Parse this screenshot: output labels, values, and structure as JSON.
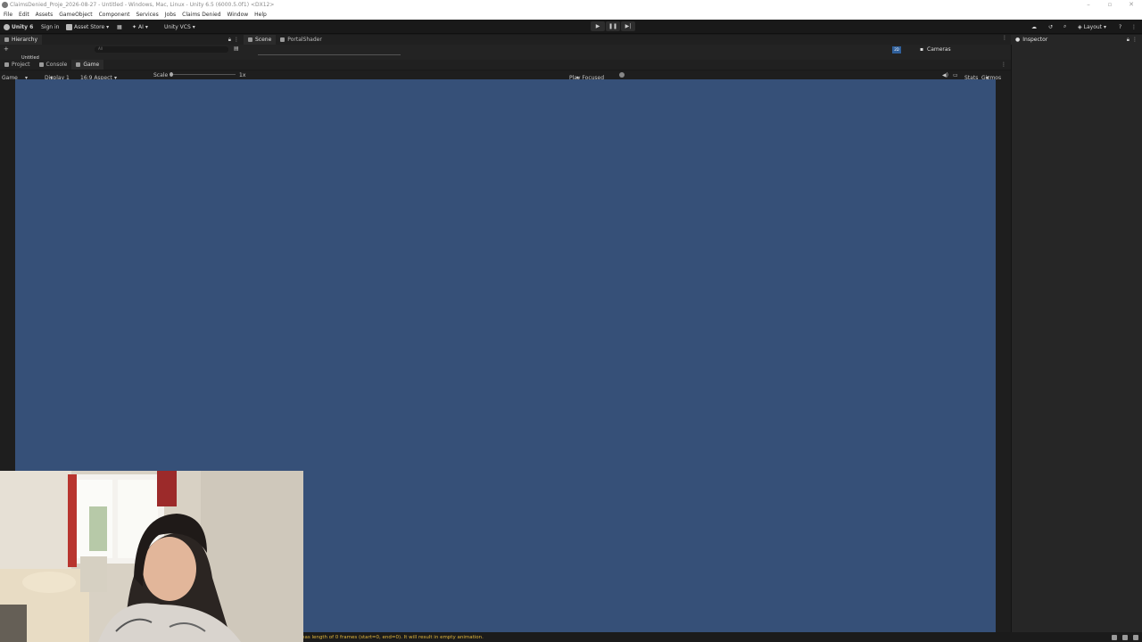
{
  "window": {
    "title": "ClaimsDenied_Proje_2026-08-27 - Untitled - Windows, Mac, Linux - Unity 6.5 (6000.5.0f1) <DX12>"
  },
  "menu": [
    "File",
    "Edit",
    "Assets",
    "GameObject",
    "Component",
    "Services",
    "Jobs",
    "Claims Denied",
    "Window",
    "Help"
  ],
  "toolbar": {
    "unity_label": "Unity 6",
    "signin_label": "Sign in",
    "asset_store_label": "Asset Store",
    "ai_label": "AI",
    "vcs_label": "Unity VCS",
    "layout_label": "Layout"
  },
  "panels": {
    "hierarchy_tab": "Hierarchy",
    "hierarchy_search_placeholder": "All",
    "hierarchy_root": "Untitled",
    "scene_tab": "Scene",
    "portal_tab": "PortalShader",
    "cameras_label": "Cameras",
    "mode_2d": "2D",
    "project_tab": "Project",
    "console_tab": "Console",
    "game_tab": "Game",
    "inspector_tab": "Inspector"
  },
  "gamebar": {
    "mode": "Game",
    "display": "Display 1",
    "aspect": "16:9 Aspect",
    "scale_label": "Scale",
    "scale_value": "1x",
    "play_focused": "Play Focused",
    "stats": "Stats",
    "gizmos": "Gizmos"
  },
  "status": {
    "message": "has length of 0 frames (start=0, end=0). It will result in empty animation."
  },
  "colors": {
    "game_background": "#365078",
    "status_warning": "#e0b63c"
  }
}
